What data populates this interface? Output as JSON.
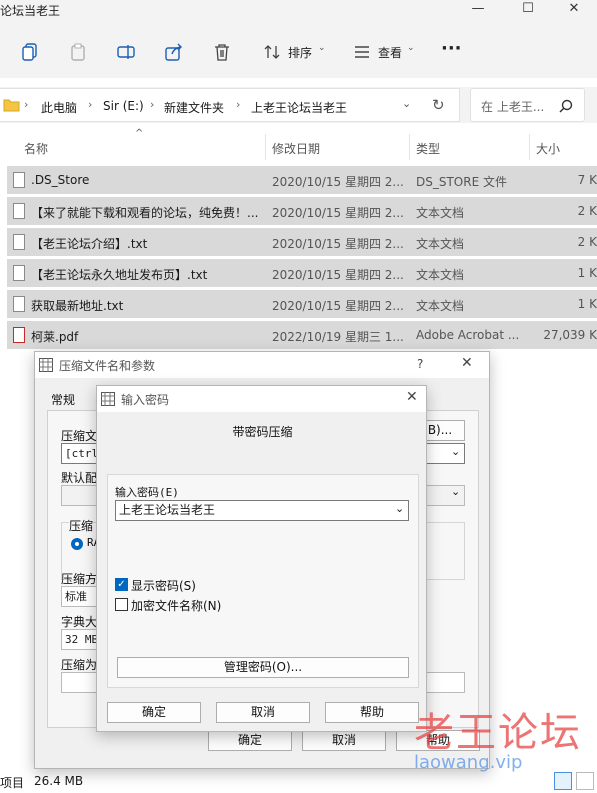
{
  "window": {
    "title": "论坛当老王"
  },
  "toolbar": {
    "sort_label": "排序",
    "view_label": "查看"
  },
  "address": {
    "crumbs": [
      "此电脑",
      "Sir (E:)",
      "新建文件夹",
      "上老王论坛当老王"
    ],
    "search_placeholder": "在 上老王..."
  },
  "columns": {
    "name": "名称",
    "date": "修改日期",
    "type": "类型",
    "size": "大小"
  },
  "files": [
    {
      "name": ".DS_Store",
      "date": "2020/10/15 星期四 2...",
      "type": "DS_STORE 文件",
      "size": "7 K",
      "icon": "file-icon",
      "selected": true
    },
    {
      "name": "【来了就能下载和观看的论坛，纯免费！...",
      "date": "2020/10/15 星期四 2...",
      "type": "文本文档",
      "size": "2 K",
      "icon": "text-file-icon",
      "selected": true
    },
    {
      "name": "【老王论坛介绍】.txt",
      "date": "2020/10/15 星期四 2...",
      "type": "文本文档",
      "size": "2 K",
      "icon": "text-file-icon",
      "selected": true
    },
    {
      "name": "【老王论坛永久地址发布页】.txt",
      "date": "2020/10/15 星期四 2...",
      "type": "文本文档",
      "size": "1 K",
      "icon": "text-file-icon",
      "selected": true
    },
    {
      "name": "获取最新地址.txt",
      "date": "2020/10/15 星期四 2...",
      "type": "文本文档",
      "size": "1 K",
      "icon": "text-file-icon",
      "selected": true
    },
    {
      "name": "柯莱.pdf",
      "date": "2022/10/19 星期三 1...",
      "type": "Adobe Acrobat ...",
      "size": "27,039 K",
      "icon": "pdf-icon",
      "selected": true
    }
  ],
  "status": {
    "items": "项目",
    "size": "26.4 MB"
  },
  "archive_dialog": {
    "title": "压缩文件名和参数",
    "help_glyph": "?",
    "tab": "常规",
    "label_filename": "压缩文",
    "filename_value": "[ctrl:",
    "browse_suffix": "B)...",
    "label_profile": "默认配",
    "label_format": "压缩",
    "format_radio": "RA",
    "label_method": "压缩方",
    "method_value": "标准",
    "label_dict": "字典大",
    "dict_value": "32 MB",
    "label_split": "压缩为",
    "ok": "确定",
    "cancel": "取消",
    "help": "帮助"
  },
  "password_dialog": {
    "title": "输入密码",
    "heading": "带密码压缩",
    "label_password": "输入密码(E)",
    "password_value": "上老王论坛当老王",
    "show_password": "显示密码(S)",
    "show_password_checked": true,
    "encrypt_names": "加密文件名称(N)",
    "encrypt_names_checked": false,
    "manage_button": "管理密码(O)...",
    "ok": "确定",
    "cancel": "取消",
    "help": "帮助"
  },
  "watermark": {
    "main": "老王论坛",
    "url": "laowang.vip"
  }
}
